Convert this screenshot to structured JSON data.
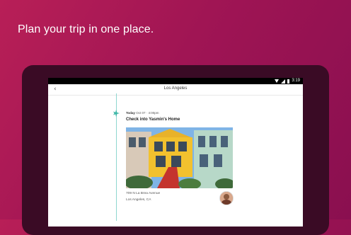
{
  "headline": "Plan your trip in one place.",
  "statusbar": {
    "time": "3:19"
  },
  "appbar": {
    "back_glyph": "‹",
    "title": "Los Angeles"
  },
  "event": {
    "day": "Today",
    "date_time": "Oct 07 · 4:00pm",
    "title": "Check into Yasmin's Home",
    "address_line1": "709 N La Brea Avenue",
    "address_line2": "Los Angeles, CA"
  },
  "icons": {
    "pin": "plane-pin-icon",
    "back": "back-arrow-icon"
  },
  "colors": {
    "background": "#a01554",
    "timeline": "#8fd6d0",
    "pin": "#3fb8a8"
  }
}
